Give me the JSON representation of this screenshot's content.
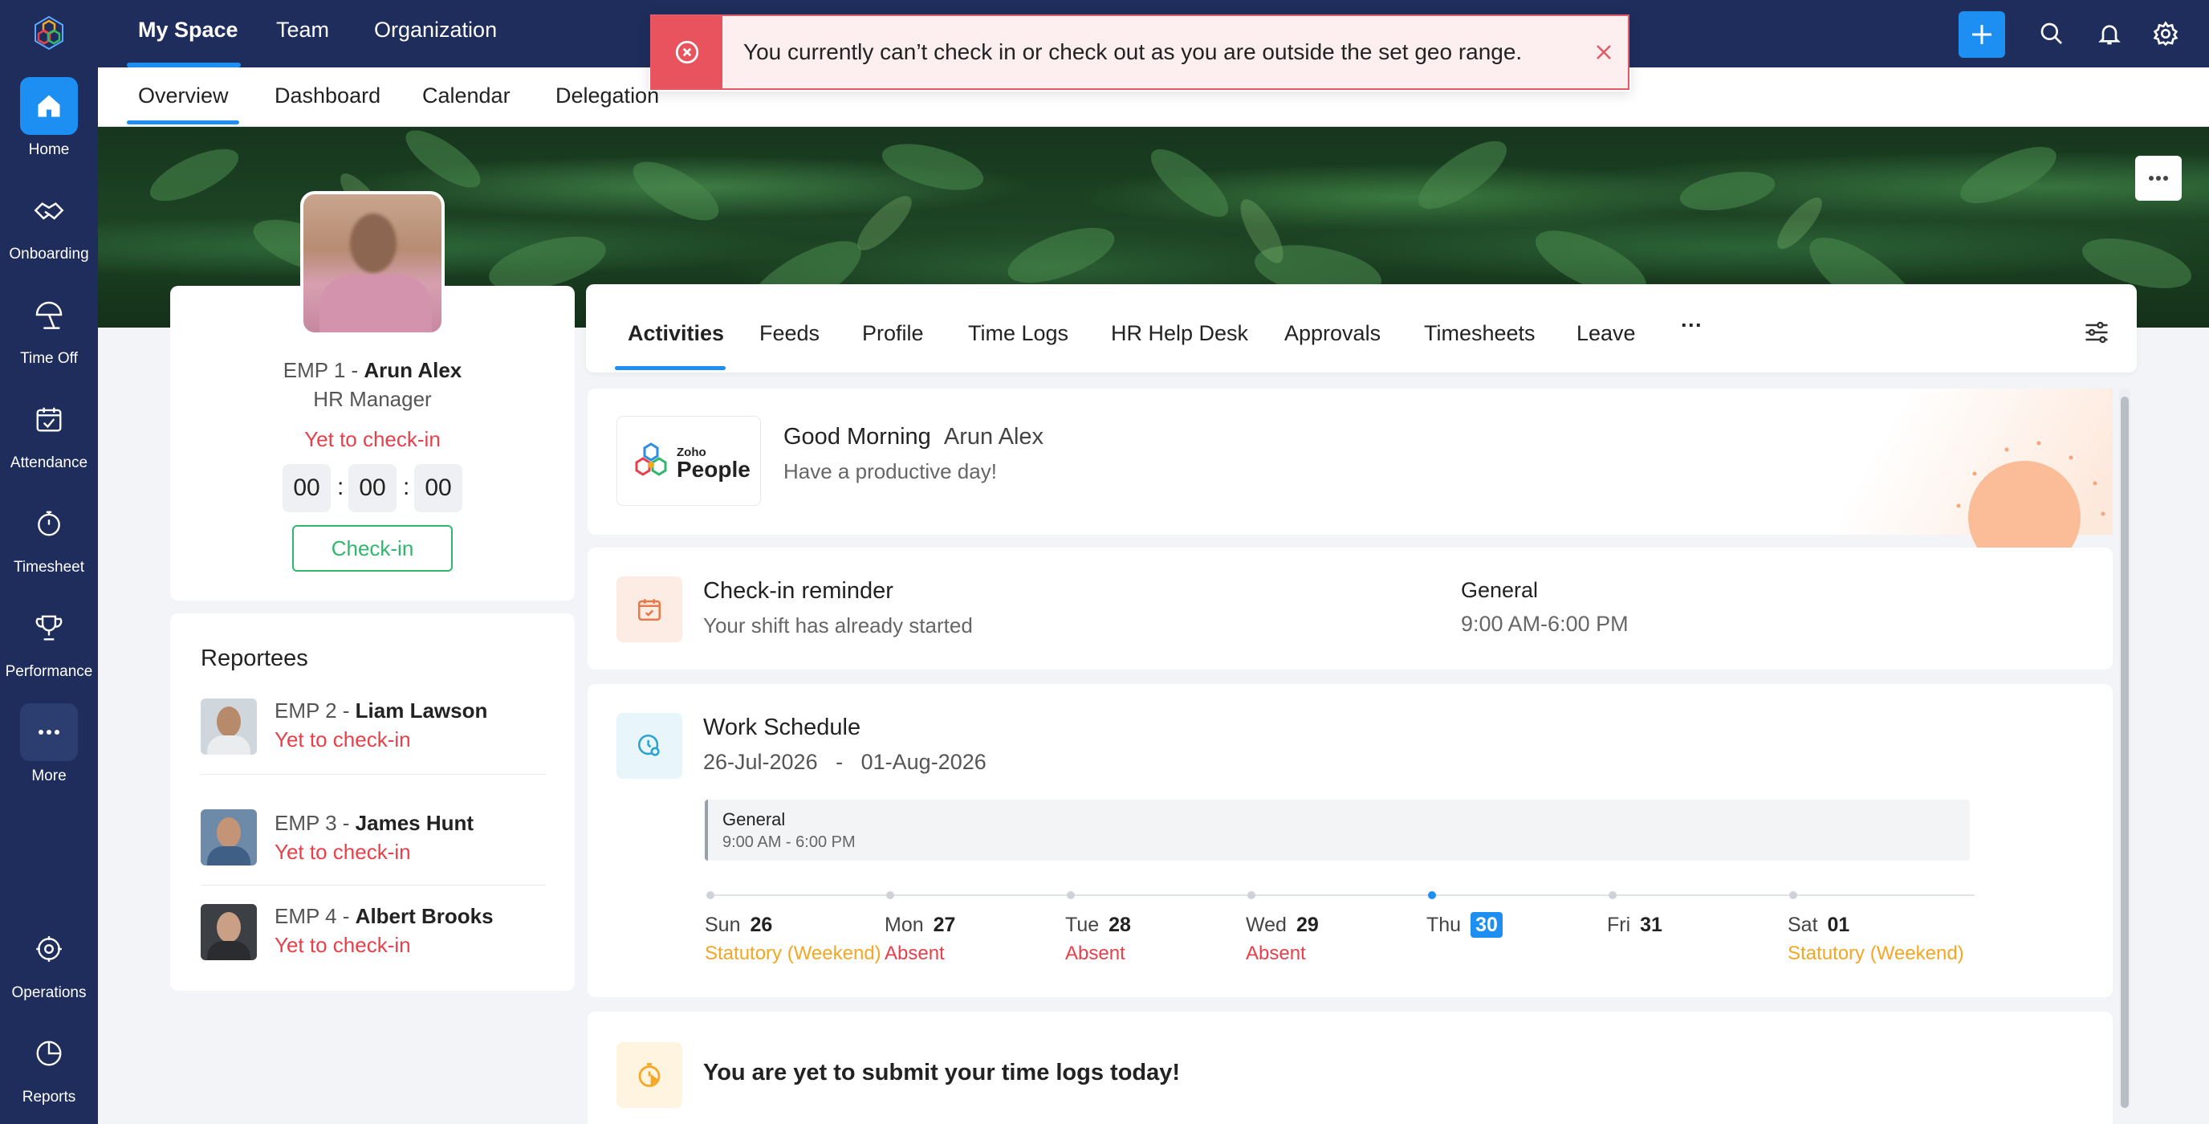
{
  "sidebar": {
    "items": [
      {
        "label": "Home",
        "icon": "home-icon"
      },
      {
        "label": "Onboarding",
        "icon": "handshake-icon"
      },
      {
        "label": "Time Off",
        "icon": "beach-umbrella-icon"
      },
      {
        "label": "Attendance",
        "icon": "calendar-check-icon"
      },
      {
        "label": "Timesheet",
        "icon": "stopwatch-icon"
      },
      {
        "label": "Performance",
        "icon": "trophy-icon"
      },
      {
        "label": "More",
        "icon": "more-icon"
      },
      {
        "label": "Operations",
        "icon": "operations-icon"
      },
      {
        "label": "Reports",
        "icon": "pie-chart-icon"
      }
    ]
  },
  "topnav": {
    "tabs": [
      "My Space",
      "Team",
      "Organization"
    ]
  },
  "subnav": {
    "tabs": [
      "Overview",
      "Dashboard",
      "Calendar",
      "Delegation"
    ]
  },
  "toast": {
    "message": "You currently can’t check in or check out as you are outside the set geo range."
  },
  "profile": {
    "emp_id": "EMP 1 - ",
    "name": "Arun Alex",
    "role": "HR Manager",
    "status": "Yet to check-in",
    "timer": [
      "00",
      "00",
      "00"
    ],
    "checkin_label": "Check-in"
  },
  "reportees": {
    "title": "Reportees",
    "items": [
      {
        "emp": "EMP 2 - ",
        "name": "Liam Lawson",
        "status": "Yet to check-in"
      },
      {
        "emp": "EMP 3 - ",
        "name": "James Hunt",
        "status": "Yet to check-in"
      },
      {
        "emp": "EMP 4 - ",
        "name": "Albert Brooks",
        "status": "Yet to check-in"
      }
    ]
  },
  "main_tabs": [
    "Activities",
    "Feeds",
    "Profile",
    "Time Logs",
    "HR Help Desk",
    "Approvals",
    "Timesheets",
    "Leave",
    "···"
  ],
  "greeting": {
    "logo_small": "Zoho",
    "logo_big": "People",
    "title": "Good Morning",
    "name": "Arun Alex",
    "subtitle": "Have a productive day!"
  },
  "reminder": {
    "title": "Check-in reminder",
    "subtitle": "Your shift has already started",
    "shift_name": "General",
    "shift_time": "9:00 AM-6:00 PM"
  },
  "schedule": {
    "title": "Work Schedule",
    "range_start": "26-Jul-2026",
    "range_sep": "-",
    "range_end": "01-Aug-2026",
    "shift_name": "General",
    "shift_time": "9:00 AM - 6:00 PM",
    "days": [
      {
        "day": "Sun",
        "date": "26",
        "status": "Statutory (Weekend)",
        "status_color": "#f5a623",
        "today": false
      },
      {
        "day": "Mon",
        "date": "27",
        "status": "Absent",
        "status_color": "#e8404a",
        "today": false
      },
      {
        "day": "Tue",
        "date": "28",
        "status": "Absent",
        "status_color": "#e8404a",
        "today": false
      },
      {
        "day": "Wed",
        "date": "29",
        "status": "Absent",
        "status_color": "#e8404a",
        "today": false
      },
      {
        "day": "Thu",
        "date": "30",
        "status": "",
        "status_color": "#222222",
        "today": true
      },
      {
        "day": "Fri",
        "date": "31",
        "status": "",
        "status_color": "#222222",
        "today": false
      },
      {
        "day": "Sat",
        "date": "01",
        "status": "Statutory (Weekend)",
        "status_color": "#f5a623",
        "today": false
      }
    ]
  },
  "timelog": {
    "title": "You are yet to submit your time logs today!"
  },
  "colors": {
    "nav_bg": "#1e2d5c",
    "accent": "#1d8ef2",
    "error": "#e8404a",
    "success": "#2fb86b",
    "weekend": "#f5a623"
  }
}
